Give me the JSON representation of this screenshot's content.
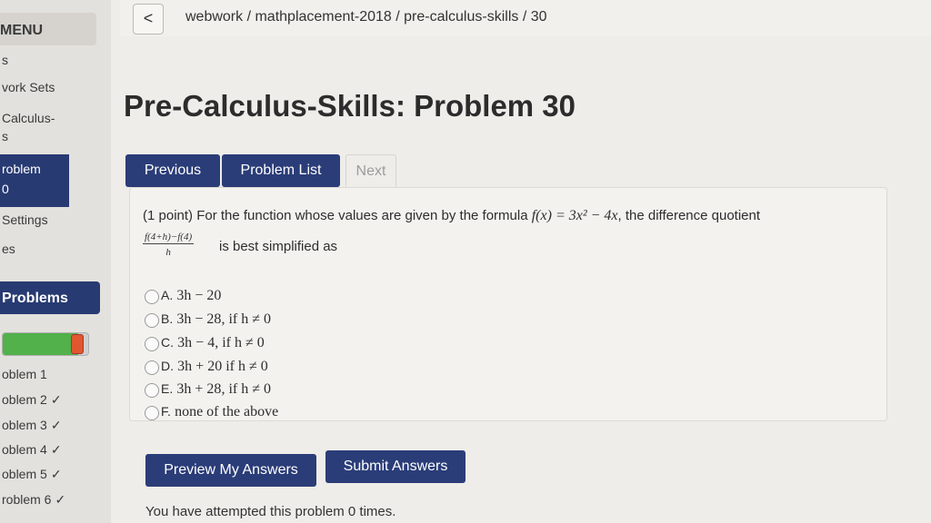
{
  "sidebar": {
    "menu_label": "MENU",
    "item_s": "s",
    "homework_sets": "vork Sets",
    "set_name_line1": "Calculus-",
    "set_name_line2": "s",
    "current_problem_line1": "roblem",
    "current_problem_line2": "0",
    "settings": "Settings",
    "item_es": "es",
    "problems_header": "Problems",
    "problem_items": [
      {
        "label": "oblem 1",
        "check": ""
      },
      {
        "label": "oblem 2",
        "check": "✓"
      },
      {
        "label": "oblem 3",
        "check": "✓"
      },
      {
        "label": "oblem 4",
        "check": "✓"
      },
      {
        "label": "oblem 5",
        "check": "✓"
      },
      {
        "label": "roblem 6",
        "check": "✓"
      }
    ],
    "progress_percent": 88
  },
  "breadcrumb": {
    "back_symbol": "<",
    "path": "webwork / mathplacement-2018 / pre-calculus-skills / 30"
  },
  "title": "Pre-Calculus-Skills: Problem 30",
  "nav": {
    "previous": "Previous",
    "problem_list": "Problem List",
    "next": "Next"
  },
  "problem": {
    "prefix": "(1 point) For the function whose values are given by the formula",
    "formula": "f(x) = 3x² − 4x",
    "suffix": ", the difference quotient",
    "fraction_numerator": "f(4+h)−f(4)",
    "fraction_denominator": "h",
    "tail": "is best simplified as",
    "choices": [
      {
        "letter": "A.",
        "expr": "3h − 20",
        "cond": ""
      },
      {
        "letter": "B.",
        "expr": "3h − 28",
        "cond": ", if h ≠ 0"
      },
      {
        "letter": "C.",
        "expr": "3h − 4",
        "cond": ", if h ≠ 0"
      },
      {
        "letter": "D.",
        "expr": "3h + 20",
        "cond": " if h ≠ 0"
      },
      {
        "letter": "E.",
        "expr": "3h + 28",
        "cond": ", if h ≠ 0"
      },
      {
        "letter": "F.",
        "expr": "none of the above",
        "cond": ""
      }
    ]
  },
  "actions": {
    "preview": "Preview My Answers",
    "submit": "Submit Answers"
  },
  "attempts_text": "You have attempted this problem 0 times."
}
